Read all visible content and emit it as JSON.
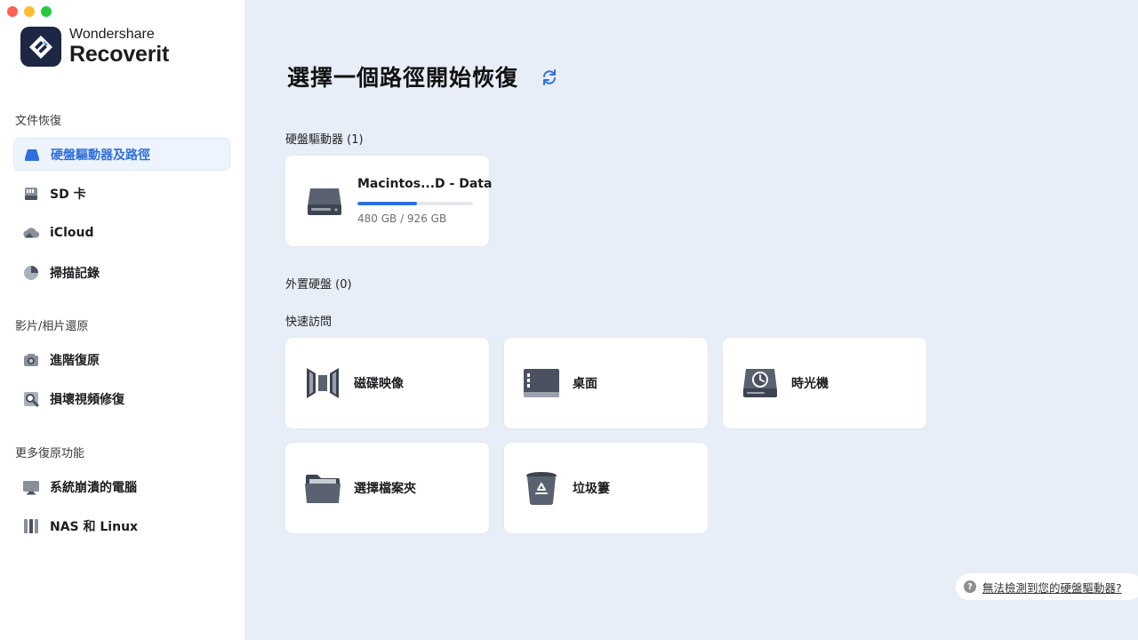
{
  "window": {
    "controls": [
      "close",
      "minimize",
      "zoom"
    ]
  },
  "brand": {
    "top": "Wondershare",
    "name": "Recoverit"
  },
  "sidebar": {
    "sections": [
      {
        "label": "文件恢復",
        "items": [
          {
            "label": "硬盤驅動器及路徑",
            "icon": "hard-drive-icon",
            "active": true
          },
          {
            "label": "SD 卡",
            "icon": "sd-card-icon"
          },
          {
            "label": "iCloud",
            "icon": "cloud-icon"
          },
          {
            "label": "掃描記錄",
            "icon": "pie-chart-icon"
          }
        ]
      },
      {
        "label": "影片/相片還原",
        "items": [
          {
            "label": "進階復原",
            "icon": "camera-icon"
          },
          {
            "label": "損壞視頻修復",
            "icon": "video-repair-icon"
          }
        ]
      },
      {
        "label": "更多復原功能",
        "items": [
          {
            "label": "系統崩潰的電腦",
            "icon": "monitor-icon"
          },
          {
            "label": "NAS 和 Linux",
            "icon": "nas-icon"
          }
        ]
      }
    ]
  },
  "main": {
    "title": "選擇一個路徑開始恢復",
    "hard_drives": {
      "label": "硬盤驅動器 (1)",
      "drives": [
        {
          "name": "Macintos...D - Data",
          "size": "480 GB / 926 GB",
          "used_fraction": 0.518
        }
      ]
    },
    "external": {
      "label": "外置硬盤 (0)"
    },
    "quick_access": {
      "label": "快速訪問",
      "items": [
        {
          "label": "磁碟映像",
          "icon": "disk-image-icon"
        },
        {
          "label": "桌面",
          "icon": "desktop-icon"
        },
        {
          "label": "時光機",
          "icon": "time-machine-icon"
        },
        {
          "label": "選擇檔案夾",
          "icon": "folder-icon"
        },
        {
          "label": "垃圾簍",
          "icon": "trash-icon"
        }
      ]
    }
  },
  "help": {
    "icon": "question-icon",
    "text": "無法檢測到您的硬盤驅動器?"
  },
  "colors": {
    "accent": "#2f6fdd",
    "main_background": "#e8eef8",
    "sidebar_background": "#ffffff",
    "brand_logo": "#1c2743"
  }
}
